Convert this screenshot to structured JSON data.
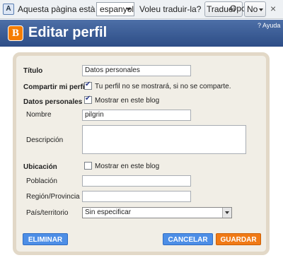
{
  "translate_bar": {
    "message": "Aquesta pàgina està en",
    "language": "espanyol",
    "question": "Voleu traduir-la?",
    "translate_button": "Traduei",
    "options_button": "Opcions",
    "no_button": "No",
    "close": "×"
  },
  "header": {
    "logo": "B",
    "title": "Editar perfil",
    "help": "? Ayuda"
  },
  "form": {
    "titulo_label": "Título",
    "titulo_value": "Datos personales",
    "compartir_label": "Compartir mi perfil",
    "compartir_text": "Tu perfil no se mostrará, si no se comparte.",
    "datos_label": "Datos personales",
    "datos_text": "Mostrar en este blog",
    "nombre_label": "Nombre",
    "nombre_value": "pilgrin",
    "descripcion_label": "Descripción",
    "descripcion_value": "",
    "ubicacion_label": "Ubicación",
    "ubicacion_text": "Mostrar en este blog",
    "poblacion_label": "Población",
    "region_label": "Región/Provincia",
    "pais_label": "País/territorio",
    "pais_value": "Sin especificar"
  },
  "buttons": {
    "eliminar": "ELIMINAR",
    "cancelar": "CANCELAR",
    "guardar": "GUARDAR"
  }
}
